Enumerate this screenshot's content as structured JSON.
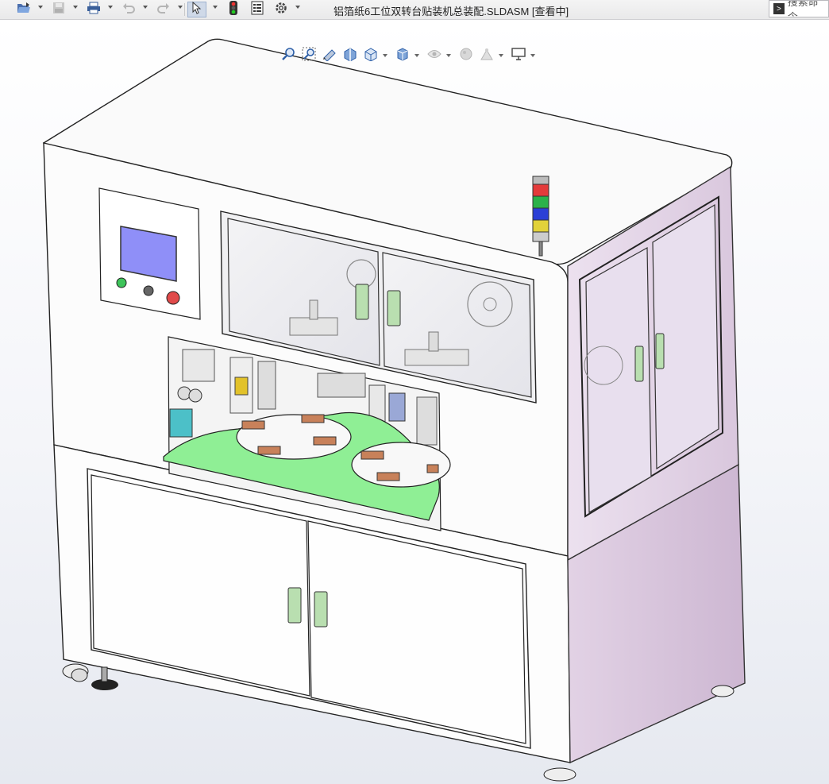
{
  "window": {
    "title": "铝箔纸6工位双转台贴装机总装配.SLDASM [查看中]"
  },
  "command_search": {
    "placeholder": "搜索命令"
  },
  "toolbar": {
    "items": [
      {
        "name": "open-document",
        "icon": "open-icon",
        "has_dropdown": true
      },
      {
        "name": "save-document",
        "icon": "save-icon",
        "has_dropdown": true,
        "disabled": true
      },
      {
        "name": "print",
        "icon": "print-icon",
        "has_dropdown": true
      },
      {
        "name": "undo",
        "icon": "undo-icon",
        "has_dropdown": true,
        "disabled": true
      },
      {
        "name": "redo",
        "icon": "redo-icon",
        "has_dropdown": true,
        "disabled": true
      },
      {
        "name": "select",
        "icon": "select-cursor-icon",
        "has_dropdown": true,
        "active": true
      },
      {
        "name": "rebuild",
        "icon": "traffic-light-icon"
      },
      {
        "name": "file-properties",
        "icon": "file-properties-icon"
      },
      {
        "name": "options",
        "icon": "gear-icon",
        "has_dropdown": true
      }
    ]
  },
  "view_toolbar": {
    "items": [
      {
        "name": "zoom-to-fit",
        "icon": "zoom-to-fit-icon"
      },
      {
        "name": "zoom-to-area",
        "icon": "zoom-to-area-icon"
      },
      {
        "name": "previous-view",
        "icon": "previous-view-icon"
      },
      {
        "name": "section-view",
        "icon": "section-view-icon"
      },
      {
        "name": "view-orientation",
        "icon": "view-orientation-icon",
        "has_dropdown": true
      },
      {
        "name": "display-style",
        "icon": "display-style-icon",
        "has_dropdown": true
      },
      {
        "name": "hide-show-items",
        "icon": "hide-show-icon",
        "has_dropdown": true,
        "disabled": true
      },
      {
        "name": "edit-appearance",
        "icon": "appearance-icon",
        "disabled": true
      },
      {
        "name": "apply-scene",
        "icon": "scene-icon",
        "has_dropdown": true,
        "disabled": true
      },
      {
        "name": "view-settings",
        "icon": "monitor-icon",
        "has_dropdown": true
      }
    ]
  },
  "colors": {
    "frame_white": "#fbfbfb",
    "side_panel_lavender": "#dcc9e0",
    "lower_side_lavender": "#d6c4da",
    "door_handle_green": "#b9dfb0",
    "workplate_green": "#8fef95",
    "hmi_screen_blue": "#8f8ff8",
    "button_green": "#3ec45a",
    "button_red": "#e04a4a",
    "tower_red": "#e43b3b",
    "tower_green": "#2bb24a",
    "tower_blue": "#2b3fd6",
    "tower_yellow": "#e2d23a",
    "part_copper": "#c8815a"
  }
}
